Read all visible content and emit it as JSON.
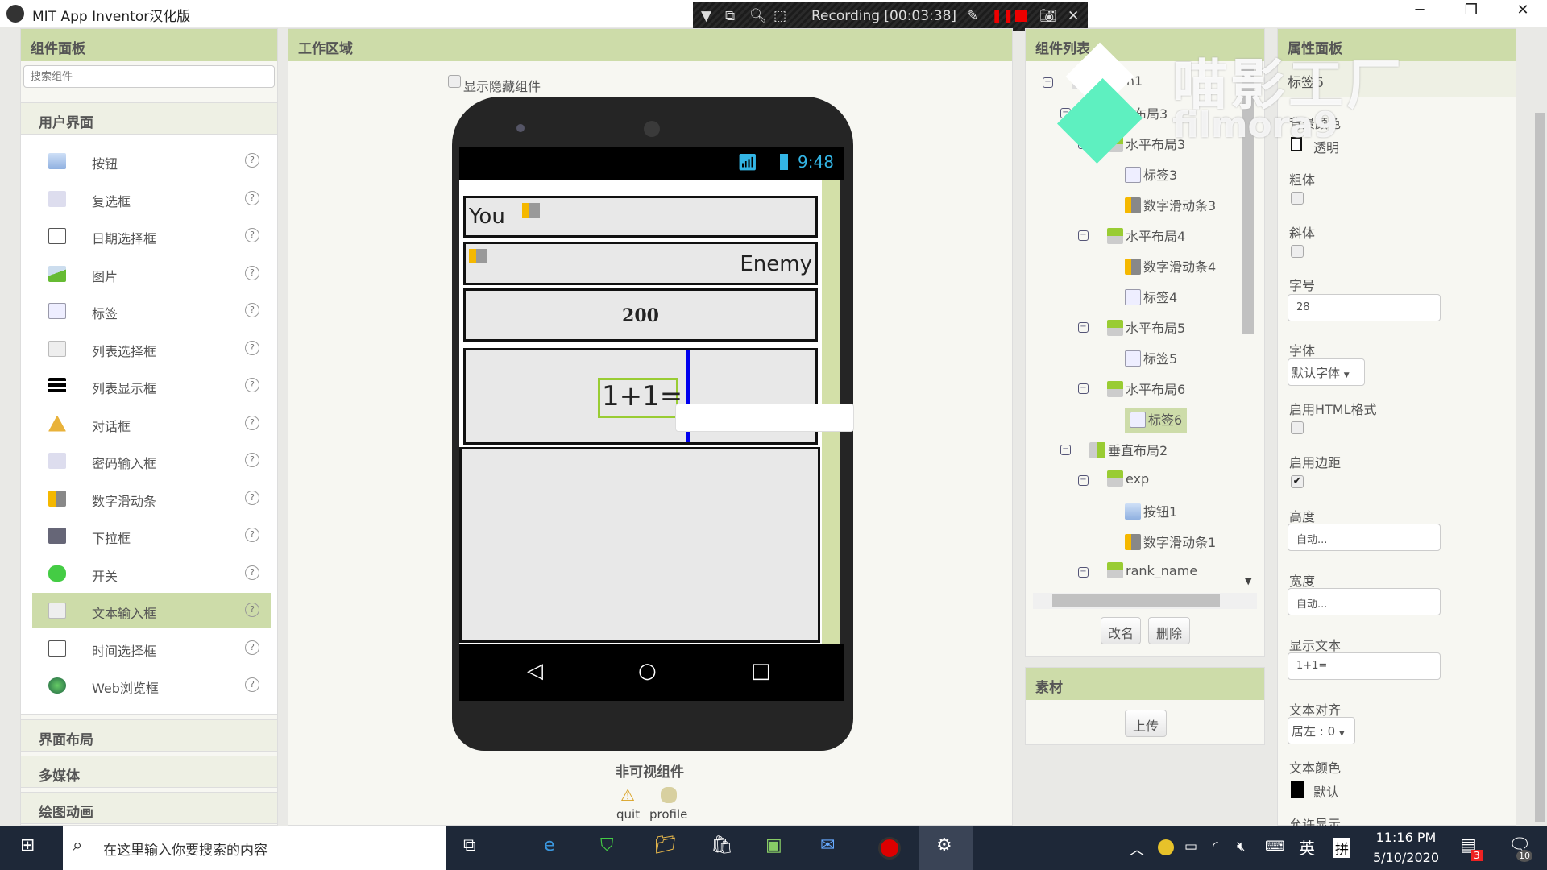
{
  "window": {
    "title": "MIT App Inventor汉化版",
    "minimize": "─",
    "restore": "❐",
    "close": "✕"
  },
  "recorder": {
    "status": "Recording [00:03:38]",
    "icons": [
      "dropdown-icon",
      "window-icon",
      "zoom-icon",
      "region-icon",
      "pen-icon",
      "pause-icon",
      "stop-icon",
      "camera-icon",
      "close-icon"
    ]
  },
  "watermark": {
    "brand": "喵影工厂",
    "product": "filmora9"
  },
  "palette": {
    "title": "组件面板",
    "search_placeholder": "搜索组件",
    "category": "用户界面",
    "items": [
      {
        "label": "按钮",
        "icon": "button-icon"
      },
      {
        "label": "复选框",
        "icon": "checkbox-icon"
      },
      {
        "label": "日期选择框",
        "icon": "calendar-icon"
      },
      {
        "label": "图片",
        "icon": "image-icon"
      },
      {
        "label": "标签",
        "icon": "label-icon"
      },
      {
        "label": "列表选择框",
        "icon": "listpicker-icon"
      },
      {
        "label": "列表显示框",
        "icon": "listview-icon"
      },
      {
        "label": "对话框",
        "icon": "warning-icon"
      },
      {
        "label": "密码输入框",
        "icon": "password-icon"
      },
      {
        "label": "数字滑动条",
        "icon": "slider-icon"
      },
      {
        "label": "下拉框",
        "icon": "spinner-icon"
      },
      {
        "label": "开关",
        "icon": "switch-icon"
      },
      {
        "label": "文本输入框",
        "icon": "textbox-icon"
      },
      {
        "label": "时间选择框",
        "icon": "clock-icon"
      },
      {
        "label": "Web浏览框",
        "icon": "globe-icon"
      }
    ],
    "help": "?",
    "selected": "文本输入框",
    "sections": [
      "界面布局",
      "多媒体",
      "绘图动画"
    ]
  },
  "workspace": {
    "title": "工作区域",
    "show_hidden": "显示隐藏组件",
    "time": "9:48",
    "rows": {
      "you": "You",
      "enemy": "Enemy",
      "score": "200",
      "question": "1+1="
    },
    "nonvisible_title": "非可视组件",
    "nonvisible": [
      {
        "label": "quit",
        "icon": "warning-icon"
      },
      {
        "label": "profile",
        "icon": "database-icon"
      }
    ]
  },
  "tree": {
    "title": "组件列表",
    "nodes": [
      {
        "label": "Screen1",
        "type": "screen"
      },
      {
        "label": "垂直布局3",
        "type": "vlayout"
      },
      {
        "label": "水平布局3",
        "type": "hlayout"
      },
      {
        "label": "标签3",
        "type": "label"
      },
      {
        "label": "数字滑动条3",
        "type": "slider"
      },
      {
        "label": "水平布局4",
        "type": "hlayout"
      },
      {
        "label": "数字滑动条4",
        "type": "slider"
      },
      {
        "label": "标签4",
        "type": "label"
      },
      {
        "label": "水平布局5",
        "type": "hlayout"
      },
      {
        "label": "标签5",
        "type": "label"
      },
      {
        "label": "水平布局6",
        "type": "hlayout"
      },
      {
        "label": "标签6",
        "type": "label"
      },
      {
        "label": "垂直布局2",
        "type": "vlayout"
      },
      {
        "label": "exp",
        "type": "hlayout"
      },
      {
        "label": "按钮1",
        "type": "button"
      },
      {
        "label": "数字滑动条1",
        "type": "slider"
      },
      {
        "label": "rank_name",
        "type": "hlayout"
      }
    ],
    "selected": "标签6",
    "rename": "改名",
    "delete": "删除"
  },
  "media": {
    "title": "素材",
    "upload": "上传"
  },
  "properties": {
    "title": "属性面板",
    "component": "标签6",
    "bg_color_label": "背景颜色",
    "bg_color_value": "透明",
    "bold_label": "粗体",
    "bold": false,
    "italic_label": "斜体",
    "italic": false,
    "font_size_label": "字号",
    "font_size": "28",
    "font_label": "字体",
    "font": "默认字体",
    "html_label": "启用HTML格式",
    "html": false,
    "margin_label": "启用边距",
    "margin": true,
    "height_label": "高度",
    "height": "自动...",
    "width_label": "宽度",
    "width": "自动...",
    "text_label": "显示文本",
    "text": "1+1=",
    "align_label": "文本对齐",
    "align": "居左 : 0",
    "text_color_label": "文本颜色",
    "text_color": "默认",
    "text_color_hex": "#000000",
    "visible_label": "允许显示"
  },
  "taskbar": {
    "search": "在这里输入你要搜索的内容",
    "ime_lang": "英",
    "ime_mode": "拼",
    "time": "11:16 PM",
    "date": "5/10/2020",
    "mail_badge": "3",
    "notif_badge": "10"
  },
  "colors": {
    "header": "#cddca9",
    "selected": "#cddca9",
    "blue_cursor": "#0000ee"
  }
}
